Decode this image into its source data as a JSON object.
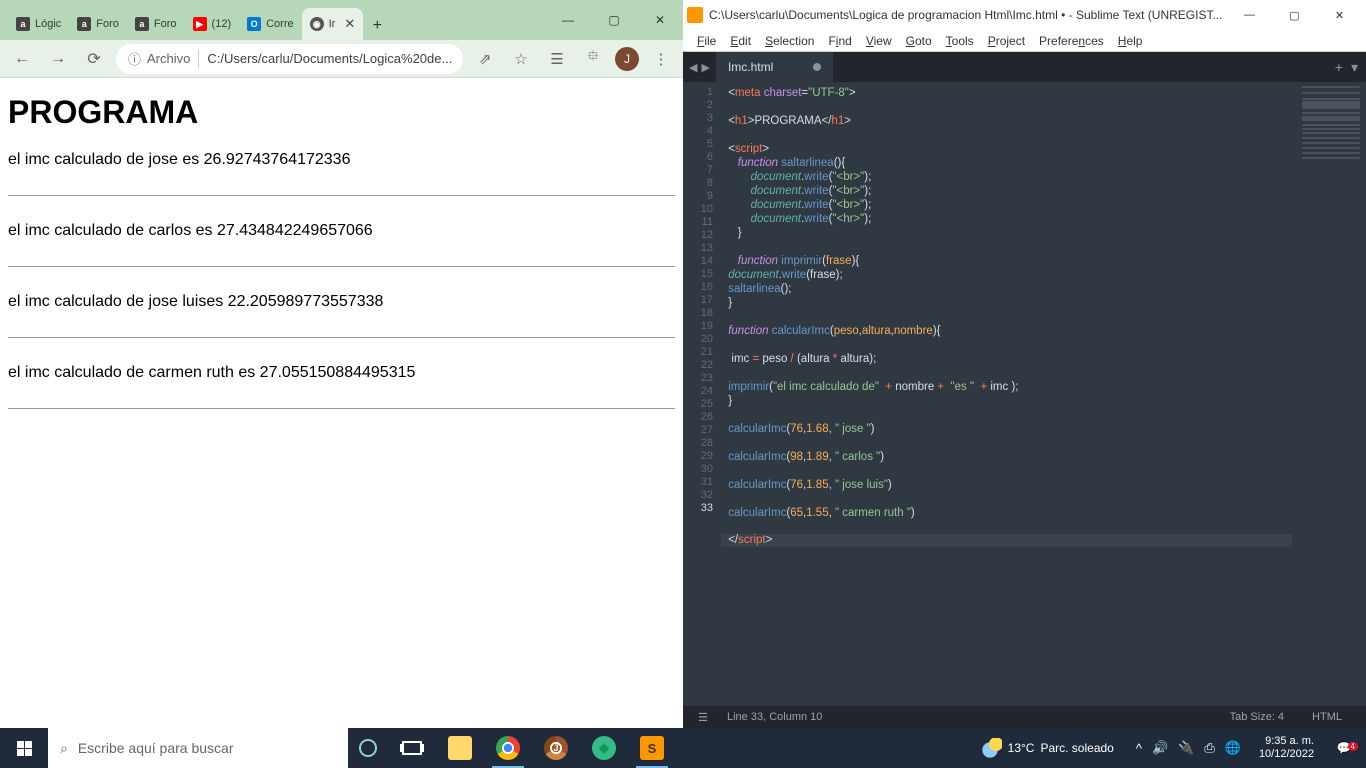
{
  "chrome": {
    "tabs": [
      {
        "fav": "a",
        "label": "Lógic"
      },
      {
        "fav": "a",
        "label": "Foro"
      },
      {
        "fav": "a",
        "label": "Foro"
      },
      {
        "fav": "yt",
        "label": "(12)"
      },
      {
        "fav": "ol",
        "label": "Corre"
      },
      {
        "fav": "gl",
        "label": "Ir",
        "active": true
      }
    ],
    "winbtns": [
      "—",
      "▢",
      "✕"
    ],
    "nav": {
      "back": "←",
      "fwd": "→",
      "reload": "⟳"
    },
    "addr_icon": "ⓘ",
    "addr_scheme": "Archivo",
    "addr_path": "C:/Users/carlu/Documents/Logica%20de...",
    "icons": {
      "share": "⇗",
      "star": "☆",
      "reader": "☰",
      "puzzle": "⯐",
      "avatar": "J",
      "more": "⋮"
    },
    "page": {
      "title": "PROGRAMA",
      "lines": [
        "el imc calculado de jose es 26.92743764172336",
        "el imc calculado de carlos es 27.434842249657066",
        "el imc calculado de jose luises 22.205989773557338",
        "el imc calculado de carmen ruth es 27.055150884495315"
      ]
    }
  },
  "sublime": {
    "title": "C:\\Users\\carlu\\Documents\\Logica de programacion Html\\Imc.html • - Sublime Text (UNREGIST...",
    "winbtns": [
      "—",
      "▢",
      "✕"
    ],
    "menu": [
      "File",
      "Edit",
      "Selection",
      "Find",
      "View",
      "Goto",
      "Tools",
      "Project",
      "Preferences",
      "Help"
    ],
    "tab": "Imc.html",
    "status": {
      "pos": "Line 33, Column 10",
      "tab": "Tab Size: 4",
      "lang": "HTML",
      "ham": "☰"
    }
  },
  "taskbar": {
    "search": "Escribe aquí para buscar",
    "weather": {
      "temp": "13°C",
      "cond": "Parc. soleado"
    },
    "tray": [
      "^",
      "🔊",
      "🔌",
      "⎙",
      "🌐"
    ],
    "clock": {
      "time": "9:35 a. m.",
      "date": "10/12/2022"
    },
    "notif": "4"
  }
}
